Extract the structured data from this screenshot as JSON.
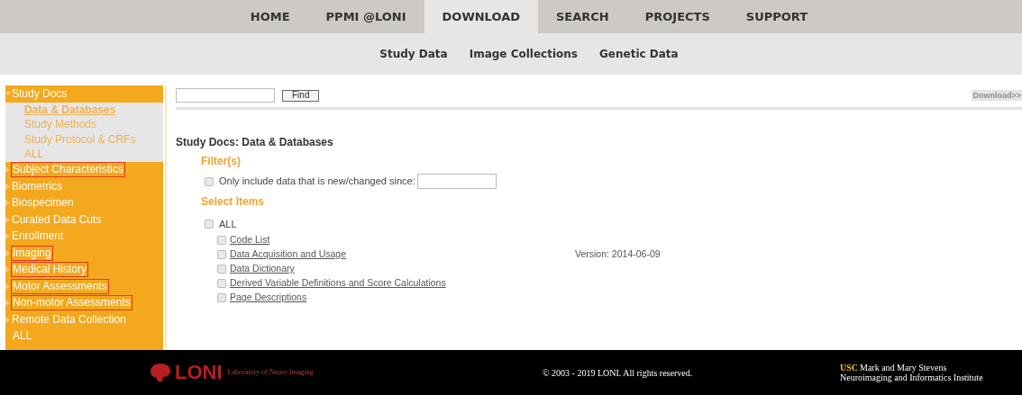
{
  "nav": {
    "tabs": [
      {
        "label": "HOME",
        "selected": false
      },
      {
        "label": "PPMI @LONI",
        "selected": false
      },
      {
        "label": "DOWNLOAD",
        "selected": true
      },
      {
        "label": "SEARCH",
        "selected": false
      },
      {
        "label": "PROJECTS",
        "selected": false
      },
      {
        "label": "SUPPORT",
        "selected": false
      }
    ],
    "subtabs": [
      "Study Data",
      "Image Collections",
      "Genetic Data"
    ]
  },
  "sidebar": {
    "items": [
      {
        "label": "Study Docs",
        "kind": "folder",
        "expanded": true,
        "highlighted": false,
        "children": [
          {
            "label": "Data & Databases",
            "selected": true
          },
          {
            "label": "Study Methods",
            "selected": false
          },
          {
            "label": "Study Protocol & CRFs",
            "selected": false
          },
          {
            "label": "ALL",
            "selected": false
          }
        ]
      },
      {
        "label": "Subject Characteristics",
        "kind": "folder",
        "expanded": false,
        "highlighted": true
      },
      {
        "label": "Biometrics",
        "kind": "folder",
        "expanded": false,
        "highlighted": false
      },
      {
        "label": "Biospecimen",
        "kind": "folder",
        "expanded": false,
        "highlighted": false
      },
      {
        "label": "Curated Data Cuts",
        "kind": "folder",
        "expanded": false,
        "highlighted": false
      },
      {
        "label": "Enrollment",
        "kind": "folder",
        "expanded": false,
        "highlighted": false
      },
      {
        "label": "Imaging",
        "kind": "folder",
        "expanded": false,
        "highlighted": true
      },
      {
        "label": "Medical History",
        "kind": "folder",
        "expanded": false,
        "highlighted": true
      },
      {
        "label": "Motor Assessments",
        "kind": "folder",
        "expanded": false,
        "highlighted": true
      },
      {
        "label": "Non-motor Assessments",
        "kind": "folder",
        "expanded": false,
        "highlighted": true
      },
      {
        "label": "Remote Data Collection",
        "kind": "folder",
        "expanded": false,
        "highlighted": false
      },
      {
        "label": "ALL",
        "kind": "link",
        "highlighted": false
      }
    ]
  },
  "toolbar": {
    "find_button": "Find",
    "download_button": "Download>>",
    "download_disabled": true
  },
  "content": {
    "heading": "Study Docs: Data & Databases",
    "filter_title": "Filter(s)",
    "filter": {
      "label": "Only include data that is new/changed since:",
      "checked": false
    },
    "select_title": "Select Items",
    "all": {
      "label": "ALL",
      "checked": false
    },
    "items": [
      {
        "label": "Code List",
        "checked": false
      },
      {
        "label": "Data Acquisition and Usage",
        "checked": false,
        "version": "Version: 2014-06-09"
      },
      {
        "label": "Data Dictionary",
        "checked": false
      },
      {
        "label": "Derived Variable Definitions and Score Calculations",
        "checked": false
      },
      {
        "label": "Page Descriptions",
        "checked": false
      }
    ]
  },
  "footer": {
    "logo": "LONI",
    "logo_subtitle": "Laboratory of Neuro Imaging",
    "copyright": "© 2003 - 2019 LONI. All rights reserved.",
    "institute_prefix": "USC",
    "institute_line1": "Mark and Mary Stevens",
    "institute_line2": "Neuroimaging and Informatics Institute"
  }
}
